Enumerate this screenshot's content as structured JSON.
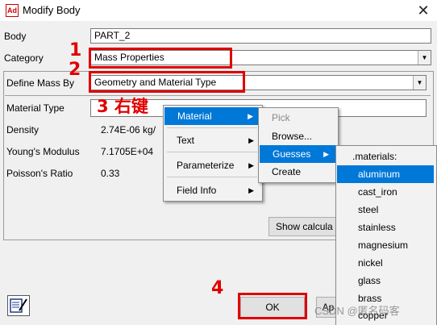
{
  "window": {
    "icon_text": "Ad",
    "title": "Modify Body",
    "close": "✕"
  },
  "form": {
    "body_label": "Body",
    "body_value": "PART_2",
    "category_label": "Category",
    "category_value": "Mass Properties",
    "define_mass_label": "Define Mass By",
    "define_mass_value": "Geometry and Material Type",
    "material_type_label": "Material Type",
    "density_label": "Density",
    "density_value": "2.74E-06 kg/",
    "youngs_label": "Young's Modulus",
    "youngs_value": "7.1705E+04",
    "poisson_label": "Poisson's Ratio",
    "poisson_value": "0.33",
    "show_calc_label": "Show calcula",
    "ok_label": "OK",
    "side_btn_label": "Ap"
  },
  "annotations": {
    "n1": "1",
    "n2": "2",
    "n3": "3 右键",
    "n4": "4"
  },
  "context_menu": {
    "items": [
      {
        "label": "Material",
        "arrow": "▶"
      },
      {
        "label": "Text",
        "arrow": "▶"
      },
      {
        "label": "Parameterize",
        "arrow": "▶"
      },
      {
        "label": "Field Info",
        "arrow": "▶"
      }
    ]
  },
  "submenu": {
    "items": [
      {
        "label": "Pick",
        "arrow": ""
      },
      {
        "label": "Browse...",
        "arrow": ""
      },
      {
        "label": "Guesses",
        "arrow": "▶"
      },
      {
        "label": "Create",
        "arrow": ""
      }
    ]
  },
  "materials_menu": {
    "header": ".materials:",
    "items": [
      "aluminum",
      "cast_iron",
      "steel",
      "stainless",
      "magnesium",
      "nickel",
      "glass",
      "brass",
      "copper"
    ]
  },
  "watermark": "CSDN @匿名码客",
  "colors": {
    "highlight": "#0078d7",
    "annotation_red": "#e00000"
  }
}
